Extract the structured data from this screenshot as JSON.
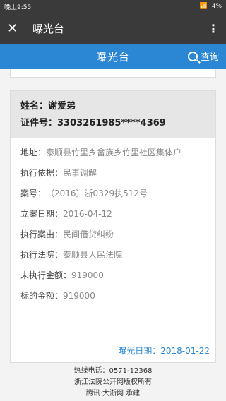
{
  "status_bar": {
    "time": "晚上9:55",
    "battery": "4%"
  },
  "app_bar": {
    "close_glyph": "✕",
    "title": "曝光台",
    "more_glyph": "⋮"
  },
  "page_header": {
    "title": "曝光台",
    "search_label": "查询"
  },
  "record": {
    "name_label": "姓名：",
    "name": "谢爱弟",
    "id_label": "证件号：",
    "id_number": "3303261985****4369",
    "address_label": "地址：",
    "address": "泰顺县竹里乡畲族乡竹里社区集体户",
    "basis_label": "执行依据：",
    "basis": "民事调解",
    "case_label": "案号：",
    "case_no": "（2016）浙0329执512号",
    "filed_label": "立案日期：",
    "filed_date": "2016-04-12",
    "cause_label": "执行案由：",
    "cause": "民间借贷纠纷",
    "court_label": "执行法院：",
    "court": "泰顺县人民法院",
    "unexecuted_label": "未执行金额：",
    "unexecuted": "919000",
    "subject_label": "标的金额：",
    "subject": "919000",
    "exposure_label": "曝光日期：",
    "exposure_date": "2018-01-22"
  },
  "footer": {
    "hotline": "热线电话：0571-12368",
    "copyright": "浙江法院公开网版权所有",
    "builder": "腾讯·大浙网 承建"
  }
}
